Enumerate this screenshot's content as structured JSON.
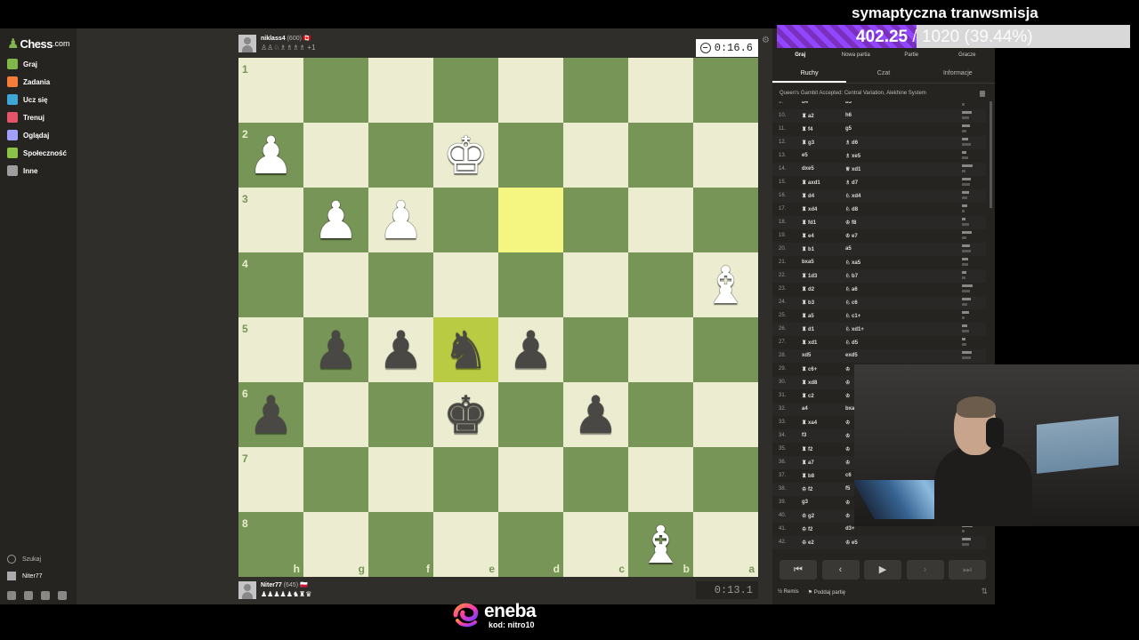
{
  "app": {
    "logo_text": "Chess",
    "logo_suffix": ".com"
  },
  "sidebar": {
    "items": [
      {
        "label": "Graj",
        "color": "#81b64c"
      },
      {
        "label": "Zadania",
        "color": "#f57c3a"
      },
      {
        "label": "Ucz się",
        "color": "#3fa5d5"
      },
      {
        "label": "Trenuj",
        "color": "#e5556a"
      },
      {
        "label": "Oglądaj",
        "color": "#a0a0ff"
      },
      {
        "label": "Społeczność",
        "color": "#8bc34a"
      },
      {
        "label": "Inne",
        "color": "#9e9e9e"
      }
    ],
    "search_label": "Szukaj",
    "user_label": "Niter77"
  },
  "top_player": {
    "name": "niklass4",
    "rating": "(600)",
    "flag": "🇨🇦",
    "captured": "♙♙♘♗♗♗♗ +1",
    "clock": "0:16.6"
  },
  "bottom_player": {
    "name": "Niter77",
    "rating": "(645)",
    "flag": "🇵🇱",
    "captured": "♟♟♟♟♟♞♜♛",
    "clock": "0:13.1"
  },
  "board": {
    "ranks": [
      "1",
      "2",
      "3",
      "4",
      "5",
      "6",
      "7",
      "8"
    ],
    "files": [
      "h",
      "g",
      "f",
      "e",
      "d",
      "c",
      "b",
      "a"
    ],
    "highlight": [
      [
        2,
        4
      ],
      [
        4,
        3
      ]
    ],
    "pieces": [
      {
        "r": 1,
        "c": 0,
        "p": "♟",
        "w": true
      },
      {
        "r": 1,
        "c": 3,
        "p": "♚",
        "w": true
      },
      {
        "r": 2,
        "c": 1,
        "p": "♟",
        "w": true
      },
      {
        "r": 2,
        "c": 2,
        "p": "♟",
        "w": true
      },
      {
        "r": 3,
        "c": 7,
        "p": "♝",
        "w": true
      },
      {
        "r": 4,
        "c": 1,
        "p": "♟",
        "w": false
      },
      {
        "r": 4,
        "c": 2,
        "p": "♟",
        "w": false
      },
      {
        "r": 4,
        "c": 3,
        "p": "♞",
        "w": false
      },
      {
        "r": 4,
        "c": 4,
        "p": "♟",
        "w": false
      },
      {
        "r": 5,
        "c": 0,
        "p": "♟",
        "w": false
      },
      {
        "r": 5,
        "c": 3,
        "p": "♚",
        "w": false
      },
      {
        "r": 5,
        "c": 5,
        "p": "♟",
        "w": false
      },
      {
        "r": 7,
        "c": 6,
        "p": "♝",
        "w": true
      }
    ]
  },
  "panel": {
    "tabs": [
      "Graj",
      "Nowa partia",
      "Partie",
      "Gracze"
    ],
    "subtabs": [
      "Ruchy",
      "Czat",
      "Informacje"
    ],
    "opening": "Queen's Gambit Accepted: Central Variation, Alekhine System",
    "moves": [
      {
        "n": "9.",
        "w": "b4",
        "b": "b5"
      },
      {
        "n": "10.",
        "w": "♜ a2",
        "b": "h6"
      },
      {
        "n": "11.",
        "w": "♜ f4",
        "b": "g5"
      },
      {
        "n": "12.",
        "w": "♜ g3",
        "b": "♗ d6"
      },
      {
        "n": "13.",
        "w": "e5",
        "b": "♗ xe5"
      },
      {
        "n": "14.",
        "w": "dxe5",
        "b": "♕ xd1"
      },
      {
        "n": "15.",
        "w": "♜ axd1",
        "b": "♗ d7"
      },
      {
        "n": "16.",
        "w": "♜ d4",
        "b": "♘ xd4"
      },
      {
        "n": "17.",
        "w": "♜ xd4",
        "b": "♘ d8"
      },
      {
        "n": "18.",
        "w": "♜ fd1",
        "b": "♔ f8"
      },
      {
        "n": "19.",
        "w": "♜ e4",
        "b": "♔ e7"
      },
      {
        "n": "20.",
        "w": "♜ b1",
        "b": "a5"
      },
      {
        "n": "21.",
        "w": "bxa5",
        "b": "♘ xa5"
      },
      {
        "n": "22.",
        "w": "♜ 1d3",
        "b": "♘ b7"
      },
      {
        "n": "23.",
        "w": "♜ d2",
        "b": "♘ a6"
      },
      {
        "n": "24.",
        "w": "♜ b3",
        "b": "♘ c6"
      },
      {
        "n": "25.",
        "w": "♜ a5",
        "b": "♘ c1+"
      },
      {
        "n": "26.",
        "w": "♜ d1",
        "b": "♘ xd1+"
      },
      {
        "n": "27.",
        "w": "♜ xd1",
        "b": "♘ d5"
      },
      {
        "n": "28.",
        "w": "xd5",
        "b": "exd5"
      },
      {
        "n": "29.",
        "w": "♜ c6+",
        "b": "♔"
      },
      {
        "n": "30.",
        "w": "♜ xd8",
        "b": "♔"
      },
      {
        "n": "31.",
        "w": "♜ c2",
        "b": "♔"
      },
      {
        "n": "32.",
        "w": "a4",
        "b": "bxa"
      },
      {
        "n": "33.",
        "w": "♜ xa4",
        "b": "♔"
      },
      {
        "n": "34.",
        "w": "f3",
        "b": "♔"
      },
      {
        "n": "35.",
        "w": "♜ f2",
        "b": "♔"
      },
      {
        "n": "36.",
        "w": "♜ a7",
        "b": "♔"
      },
      {
        "n": "37.",
        "w": "♜ b8",
        "b": "c6"
      },
      {
        "n": "38.",
        "w": "♔ f2",
        "b": "f5"
      },
      {
        "n": "39.",
        "w": "g3",
        "b": "♔"
      },
      {
        "n": "40.",
        "w": "♔ g2",
        "b": "♔"
      },
      {
        "n": "41.",
        "w": "♔ f2",
        "b": "d3+"
      },
      {
        "n": "42.",
        "w": "♔ e2",
        "b": "♔ e5"
      }
    ],
    "nav": [
      "⏮",
      "‹",
      "▶",
      "›",
      "⏭"
    ],
    "remis": "Remis",
    "resign": "Poddaj partię"
  },
  "stream": {
    "title": "symaptyczna tranwsmisja",
    "goal_current": "402.25",
    "goal_rest": " / 1020 (39.44%)",
    "goal_fraction": 0.3944,
    "sponsor_name": "eneba",
    "sponsor_code": "kod: nitro10"
  }
}
